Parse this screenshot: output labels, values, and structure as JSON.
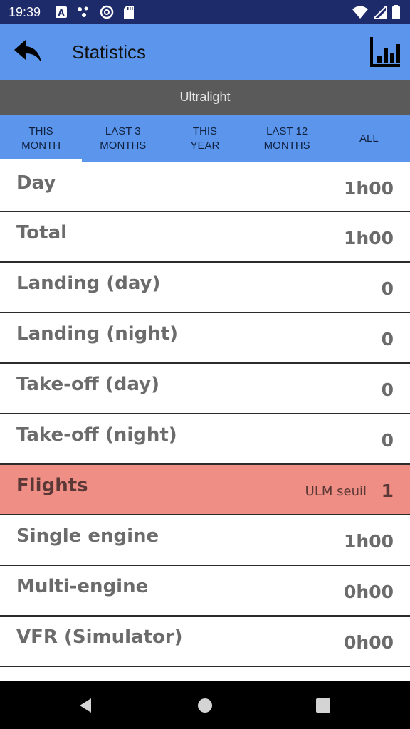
{
  "status_bar": {
    "time": "19:39",
    "icons_left": [
      "a-box-icon",
      "dots-icon",
      "at-circle-icon",
      "sd-card-icon"
    ],
    "icons_right": [
      "wifi-icon",
      "signal-icon",
      "battery-icon"
    ]
  },
  "app_bar": {
    "title": "Statistics",
    "back_icon": "reply-arrow-icon",
    "chart_icon": "bar-chart-icon"
  },
  "subtitle": "Ultralight",
  "tabs": [
    {
      "label": "THIS\nMONTH",
      "active": true
    },
    {
      "label": "LAST 3\nMONTHS",
      "active": false
    },
    {
      "label": "THIS\nYEAR",
      "active": false
    },
    {
      "label": "LAST 12\nMONTHS",
      "active": false
    },
    {
      "label": "ALL",
      "active": false
    }
  ],
  "rows": [
    {
      "label": "Day",
      "value": "1h00"
    },
    {
      "label": "Total",
      "value": "1h00"
    },
    {
      "label": "Landing (day)",
      "value": "0"
    },
    {
      "label": "Landing (night)",
      "value": "0"
    },
    {
      "label": "Take-off (day)",
      "value": "0"
    },
    {
      "label": "Take-off (night)",
      "value": "0"
    },
    {
      "label": "Flights",
      "value": "1",
      "note": "ULM seuil",
      "highlight": true
    },
    {
      "label": "Single engine",
      "value": "1h00"
    },
    {
      "label": "Multi-engine",
      "value": "0h00"
    },
    {
      "label": "VFR (Simulator)",
      "value": "0h00"
    }
  ],
  "colors": {
    "status_bar": "#1d2b6b",
    "app_bar": "#5b96ec",
    "subtitle_bar": "#5a5a5a",
    "highlight_row": "#ef8e85"
  },
  "nav_bar": [
    "back-triangle-icon",
    "home-circle-icon",
    "recents-square-icon"
  ]
}
